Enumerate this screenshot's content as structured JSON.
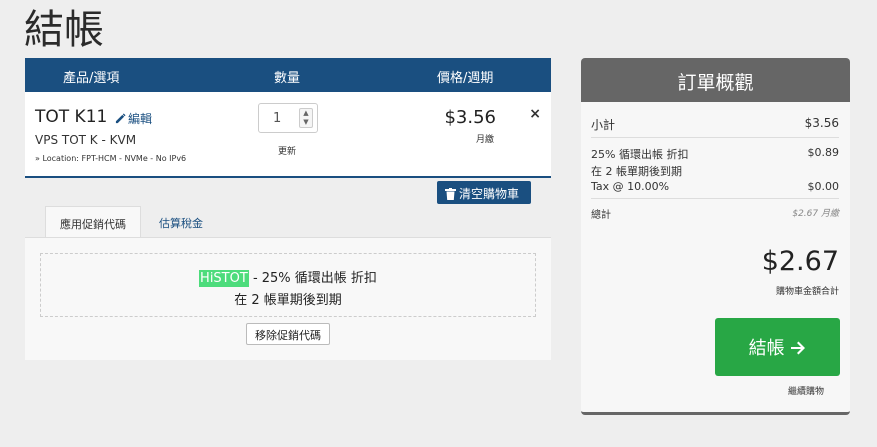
{
  "page": {
    "title": "結帳"
  },
  "cart": {
    "headers": {
      "product": "產品/選項",
      "qty": "數量",
      "price": "價格/週期"
    },
    "item": {
      "name": "TOT K11",
      "edit_label": "編輯",
      "group": "VPS TOT K - KVM",
      "options": "» Location: FPT-HCM - NVMe - No IPv6",
      "qty": "1",
      "update_label": "更新",
      "price": "$3.56",
      "cycle": "月繳",
      "remove_symbol": "×"
    },
    "empty_cart_label": "清空購物車",
    "tabs": {
      "promo": "應用促銷代碼",
      "tax": "估算稅金"
    },
    "promo": {
      "code": "HiSTOT",
      "line1_rest": " - 25% 循環出帳 折扣",
      "line2": "在 2 帳單期後到期",
      "remove_label": "移除促銷代碼"
    }
  },
  "summary": {
    "title": "訂單概觀",
    "subtotal_label": "小計",
    "subtotal_value": "$3.56",
    "discount_label": "25% 循環出帳 折扣",
    "discount_value": "$0.89",
    "discount_note": "在 2 帳單期後到期",
    "tax_label": "Tax @ 10.00%",
    "tax_value": "$0.00",
    "recurring_label": "總計",
    "recurring_value": "$2.67 月繳",
    "total_amount": "$2.67",
    "total_label": "購物車金額合計",
    "checkout_label": "結帳",
    "checkout_icon": "arrow-right-icon",
    "continue_label": "繼續購物"
  },
  "colors": {
    "primary": "#1a4f80",
    "success": "#28a745",
    "summary_header": "#666666",
    "promo_highlight": "#4ddc7c"
  }
}
